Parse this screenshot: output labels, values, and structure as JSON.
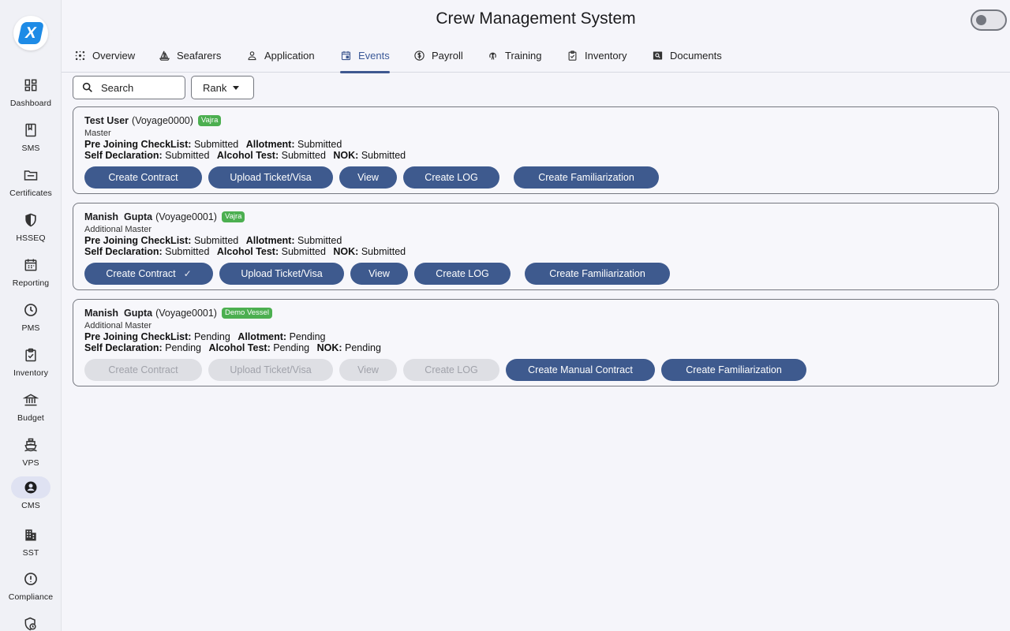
{
  "app": {
    "title": "Crew Management System",
    "logo_letter": "X"
  },
  "sidebar": {
    "items": [
      {
        "label": "Dashboard",
        "icon": "dashboard-icon"
      },
      {
        "label": "SMS",
        "icon": "book-icon"
      },
      {
        "label": "Certificates",
        "icon": "folder-icon"
      },
      {
        "label": "HSSEQ",
        "icon": "shield-icon"
      },
      {
        "label": "Reporting",
        "icon": "calendar-icon"
      },
      {
        "label": "PMS",
        "icon": "clock-icon"
      },
      {
        "label": "Inventory",
        "icon": "clipboard-check-icon"
      },
      {
        "label": "Budget",
        "icon": "bank-icon"
      },
      {
        "label": "VPS",
        "icon": "ship-icon"
      },
      {
        "label": "CMS",
        "icon": "account-circle-icon"
      },
      {
        "label": "SST",
        "icon": "building-icon"
      },
      {
        "label": "Compliance",
        "icon": "alert-circle-icon"
      }
    ],
    "active": "CMS"
  },
  "tabs": [
    {
      "label": "Overview",
      "icon": "sparkle-icon"
    },
    {
      "label": "Seafarers",
      "icon": "sailboat-icon"
    },
    {
      "label": "Application",
      "icon": "person-icon"
    },
    {
      "label": "Events",
      "icon": "event-calendar-icon"
    },
    {
      "label": "Payroll",
      "icon": "dollar-icon"
    },
    {
      "label": "Training",
      "icon": "training-icon"
    },
    {
      "label": "Inventory",
      "icon": "inventory-icon"
    },
    {
      "label": "Documents",
      "icon": "document-search-icon"
    }
  ],
  "active_tab": "Events",
  "filters": {
    "search_placeholder": "Search",
    "rank_label": "Rank"
  },
  "colors": {
    "primary_button": "#3e5a8e",
    "vessel_badge": "#4caf50",
    "active_tab": "#3f5890"
  },
  "labels": {
    "pre_joining": "Pre Joining CheckList:",
    "allotment": "Allotment:",
    "self_declaration": "Self Declaration:",
    "alcohol_test": "Alcohol Test:",
    "nok": "NOK:"
  },
  "events": [
    {
      "name": "Test User",
      "voyage": "(Voyage0000)",
      "vessel": "Vajra",
      "rank": "Master",
      "pre_joining": "Submitted",
      "allotment": "Submitted",
      "self_declaration": "Submitted",
      "alcohol_test": "Submitted",
      "nok": "Submitted",
      "buttons": [
        {
          "label": "Create Contract",
          "enabled": true
        },
        {
          "label": "Upload Ticket/Visa",
          "enabled": true
        },
        {
          "label": "View",
          "enabled": true
        },
        {
          "label": "Create LOG",
          "enabled": true
        },
        {
          "label": "Create Familiarization",
          "enabled": true
        }
      ]
    },
    {
      "name": "Manish  Gupta",
      "voyage": "(Voyage0001)",
      "vessel": "Vajra",
      "rank": "Additional Master",
      "pre_joining": "Submitted",
      "allotment": "Submitted",
      "self_declaration": "Submitted",
      "alcohol_test": "Submitted",
      "nok": "Submitted",
      "buttons": [
        {
          "label": "Create Contract",
          "enabled": true,
          "checked": true
        },
        {
          "label": "Upload Ticket/Visa",
          "enabled": true
        },
        {
          "label": "View",
          "enabled": true
        },
        {
          "label": "Create LOG",
          "enabled": true
        },
        {
          "label": "Create Familiarization",
          "enabled": true
        }
      ]
    },
    {
      "name": "Manish  Gupta",
      "voyage": "(Voyage0001)",
      "vessel": "Demo Vessel",
      "rank": "Additional Master",
      "pre_joining": "Pending",
      "allotment": "Pending",
      "self_declaration": "Pending",
      "alcohol_test": "Pending",
      "nok": "Pending",
      "buttons": [
        {
          "label": "Create Contract",
          "enabled": false
        },
        {
          "label": "Upload Ticket/Visa",
          "enabled": false
        },
        {
          "label": "View",
          "enabled": false
        },
        {
          "label": "Create LOG",
          "enabled": false
        },
        {
          "label": "Create Manual Contract",
          "enabled": true
        },
        {
          "label": "Create Familiarization",
          "enabled": true
        }
      ]
    }
  ]
}
